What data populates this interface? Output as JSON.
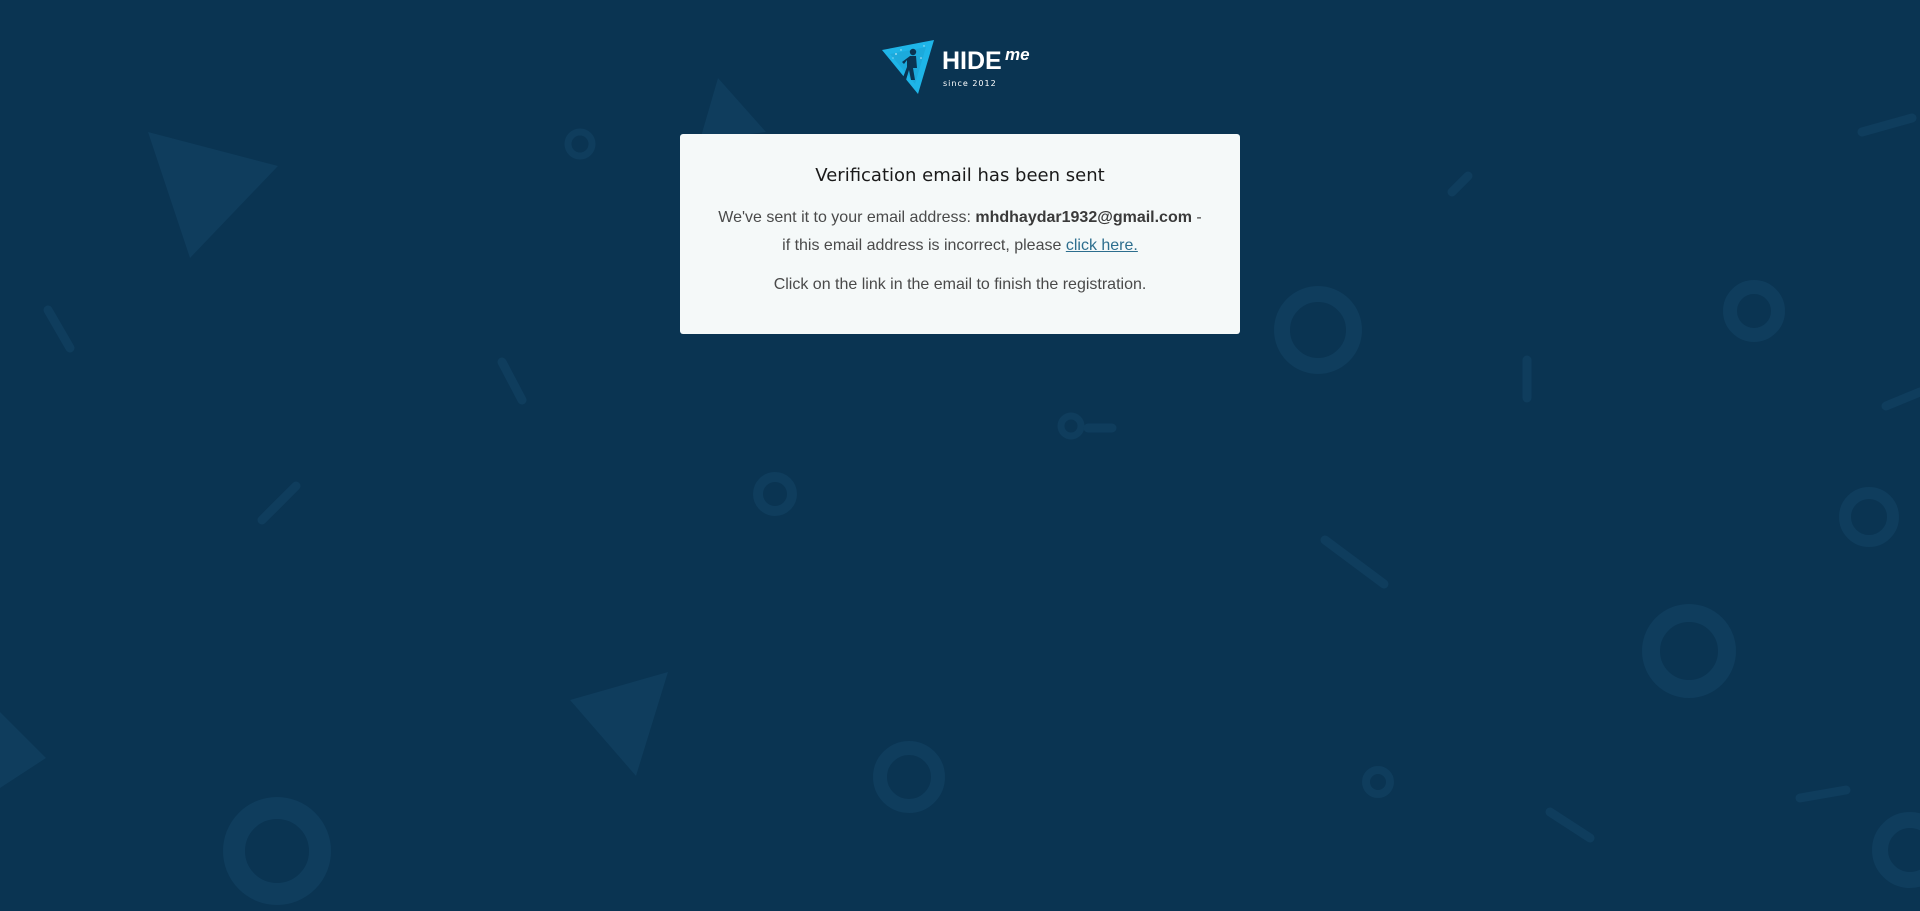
{
  "background_color": "#0a3452",
  "accent_color": "#1eb5e8",
  "logo": {
    "brand_text": "HIDE",
    "brand_suffix": "me",
    "tagline": "since 2012",
    "icon": "hide-me-triangle-icon"
  },
  "card": {
    "title": "Verification email has been sent",
    "line1_prefix": "We've sent it to your email address:",
    "email": "mhdhaydar1932@gmail.com",
    "line1_suffix": "-",
    "line2_prefix": "if this email address is incorrect, please",
    "link_text": "click here.",
    "instruction": "Click on the link in the email to finish the registration."
  }
}
